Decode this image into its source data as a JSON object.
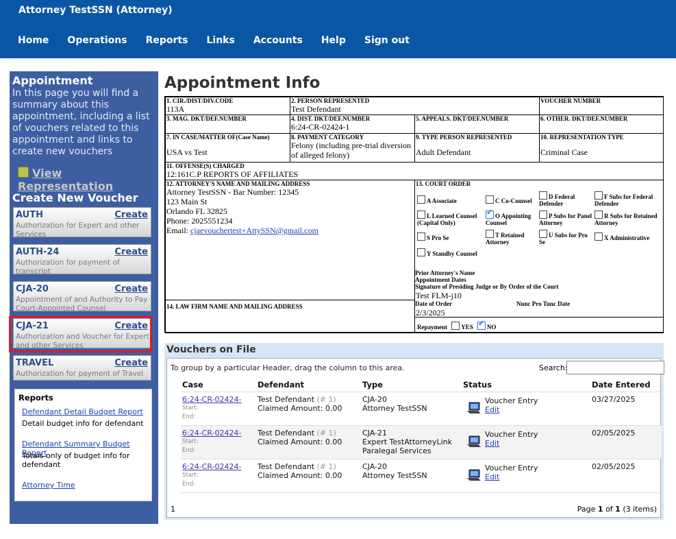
{
  "header": {
    "user": "Attorney TestSSN (Attorney)",
    "nav": [
      "Home",
      "Operations",
      "Reports",
      "Links",
      "Accounts",
      "Help",
      "Sign out"
    ]
  },
  "sidebar": {
    "title": "Appointment",
    "description": "In this page you will find a summary about this appointment, including a list of vouchers related to this appointment and links to create new vouchers",
    "view_representation": "View Representation",
    "create_title": "Create New Voucher",
    "vouchers": [
      {
        "code": "AUTH",
        "create": "Create",
        "desc": "Authorization for Expert and other Services"
      },
      {
        "code": "AUTH-24",
        "create": "Create",
        "desc": "Authorization for payment of transcript"
      },
      {
        "code": "CJA-20",
        "create": "Create",
        "desc": "Appointment of and Authority to Pay Court-Appointed Counsel"
      },
      {
        "code": "CJA-21",
        "create": "Create",
        "desc": "Authorization and Voucher for Expert and other Services"
      },
      {
        "code": "TRAVEL",
        "create": "Create",
        "desc": "Authorization for payment of Travel"
      }
    ],
    "reports": {
      "title": "Reports",
      "items": [
        {
          "link": "Defendant Detail Budget Report",
          "desc": "Detail budget info for defendant"
        },
        {
          "link": "Defendant Summary Budget Report",
          "desc": "Totals only of budget info for defendant"
        },
        {
          "link": "Attorney Time",
          "desc": ""
        }
      ]
    }
  },
  "main": {
    "title": "Appointment Info",
    "form": {
      "f1_label": "1. CIR./DIST/DIV.CODE",
      "f1_value": "113A",
      "f2_label": "2. PERSON REPRESENTED",
      "f2_value": "Test Defendant",
      "f_voucher_label": "VOUCHER NUMBER",
      "f_voucher_value": "",
      "f3_label": "3. MAG. DKT/DEF.NUMBER",
      "f3_value": "",
      "f4_label": "4. DIST. DKT/DEF.NUMBER",
      "f4_value": "6:24-CR-02424-1",
      "f5_label": "5. APPEALS. DKT/DEF.NUMBER",
      "f5_value": "",
      "f6_label": "6. OTHER. DKT/DEF.NUMBER",
      "f6_value": "",
      "f7_label": "7. IN CASE/MATTER OF(Case Name)",
      "f7_value": "USA vs Test",
      "f8_label": "8. PAYMENT CATEGORY",
      "f8_value": "Felony (including pre-trial diversion of alleged felony)",
      "f9_label": "9. TYPE PERSON REPRESENTED",
      "f9_value": "Adult Defendant",
      "f10_label": "10. REPRESENTATION TYPE",
      "f10_value": "Criminal Case",
      "f11_label": "11. OFFENSE(S) CHARGED",
      "f11_value": "12:161C.P REPORTS OF AFFILIATES",
      "f12_label": "12. ATTORNEY'S NAME AND MAILING ADDRESS",
      "f12_lines": [
        "Attorney TestSSN - Bar Number: 12345",
        "123 Main St",
        "Orlando FL 32825",
        "Phone: 2025551234"
      ],
      "f12_email_label": "Email:",
      "f12_email": "cjaevouchertest+AttySSN@gmail.com",
      "f13_label": "13. COURT ORDER",
      "f13_options": [
        {
          "label": "A Associate",
          "checked": false
        },
        {
          "label": "C Co-Counsel",
          "checked": false
        },
        {
          "label": "D Federal Defender",
          "checked": false
        },
        {
          "label": "F Subs for Federal Defender",
          "checked": false
        },
        {
          "label": "L Learned Counsel (Capital Only)",
          "checked": false
        },
        {
          "label": "O Appointing Counsel",
          "checked": true
        },
        {
          "label": "P Subs for Panel Attorney",
          "checked": false
        },
        {
          "label": "R Subs for Retained Attorney",
          "checked": false
        },
        {
          "label": "S Pro Se",
          "checked": false
        },
        {
          "label": "T Retained Attorney",
          "checked": false
        },
        {
          "label": "U Subs for Pro Se",
          "checked": false
        },
        {
          "label": "X Administrative",
          "checked": false
        },
        {
          "label": "Y Standby Counsel",
          "checked": false
        }
      ],
      "prior_attorney": "Prior Attorney's Name",
      "appointment_dates": "Appointment Dates",
      "signature_label": "Signature of Presiding Judge or By Order of the Court",
      "signature_value": "Test FLM-j10",
      "date_of_order_label": "Date of Order",
      "date_of_order_value": "2/3/2025",
      "nunc_pro_tunc_label": "Nunc Pro Tunc Date",
      "repayment_label": "Repayment",
      "repayment_yes": "YES",
      "repayment_no": "NO",
      "f14_label": "14. LAW FIRM NAME AND MAILING ADDRESS"
    },
    "vouchers_on_file": {
      "title": "Vouchers on File",
      "group_hint": "To group by a particular Header, drag the column to this area.",
      "search_label": "Search:",
      "search_value": "",
      "columns": [
        "Case",
        "Defendant",
        "Type",
        "Status",
        "Date Entered"
      ],
      "rows": [
        {
          "case": "6:24-CR-02424-",
          "defendant": "Test Defendant",
          "def_num": "(# 1)",
          "amount": "Claimed Amount: 0.00",
          "type1": "CJA-20",
          "type2": "Attorney TestSSN",
          "type3": "",
          "status": "Voucher Entry",
          "edit": "Edit",
          "date": "03/27/2025"
        },
        {
          "case": "6:24-CR-02424-",
          "defendant": "Test Defendant",
          "def_num": "(# 1)",
          "amount": "Claimed Amount: 0.00",
          "type1": "CJA-21",
          "type2": "Expert TestAttorneyLink",
          "type3": "Paralegal Services",
          "status": "Voucher Entry",
          "edit": "Edit",
          "date": "02/05/2025"
        },
        {
          "case": "6:24-CR-02424-",
          "defendant": "Test Defendant",
          "def_num": "(# 1)",
          "amount": "Claimed Amount: 0.00",
          "type1": "CJA-20",
          "type2": "Attorney TestSSN",
          "type3": "",
          "status": "Voucher Entry",
          "edit": "Edit",
          "date": "02/05/2025"
        }
      ],
      "start_label": "Start:",
      "end_label": "End:",
      "pager_left": "1",
      "pager_page_word": "Page",
      "pager_current": "1",
      "pager_of": "of",
      "pager_total": "1",
      "pager_items": "(3 items)"
    }
  }
}
